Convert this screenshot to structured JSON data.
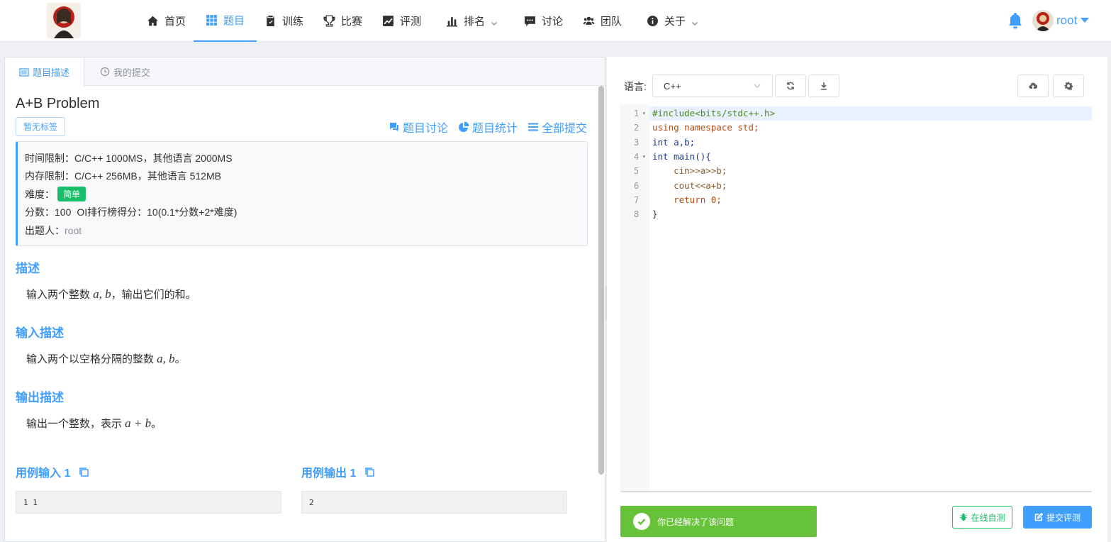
{
  "nav": {
    "items": [
      {
        "label": "首页",
        "icon": "home-icon"
      },
      {
        "label": "题目",
        "icon": "grid-icon",
        "active": true
      },
      {
        "label": "训练",
        "icon": "clipboard-icon"
      },
      {
        "label": "比赛",
        "icon": "trophy-icon"
      },
      {
        "label": "评测",
        "icon": "chart-line-icon"
      },
      {
        "label": "排名",
        "icon": "bar-chart-icon",
        "dropdown": true
      },
      {
        "label": "讨论",
        "icon": "chat-icon"
      },
      {
        "label": "团队",
        "icon": "users-icon"
      },
      {
        "label": "关于",
        "icon": "info-icon",
        "dropdown": true
      }
    ],
    "user": "root"
  },
  "tabs": {
    "description": "题目描述",
    "submissions": "我的提交"
  },
  "problem": {
    "title": "A+B Problem",
    "tag_button": "暂无标签",
    "links": {
      "discuss": "题目讨论",
      "stats": "题目统计",
      "all_submissions": "全部提交"
    },
    "info": {
      "time_limit_label": "时间限制：",
      "time_limit": "C/C++ 1000MS，其他语言 2000MS",
      "memory_limit_label": "内存限制：",
      "memory_limit": "C/C++ 256MB，其他语言 512MB",
      "difficulty_label": "难度：",
      "difficulty": "简单",
      "score_label": "分数：",
      "score": "100",
      "oi_label": "OI排行榜得分：",
      "oi_score": "10(0.1*分数+2*难度)",
      "author_label": "出题人：",
      "author": "root"
    },
    "sections": {
      "description_title": "描述",
      "description_pre": "输入两个整数 ",
      "description_math": "a, b",
      "description_post": "，输出它们的和。",
      "input_title": "输入描述",
      "input_pre": "输入两个以空格分隔的整数 ",
      "input_math": "a, b",
      "input_post": "。",
      "output_title": "输出描述",
      "output_pre": "输出一个整数，表示 ",
      "output_math": "a + b",
      "output_post": "。"
    },
    "samples": {
      "input_title": "用例输入 1",
      "input_value": "1 1",
      "output_title": "用例输出 1",
      "output_value": "2"
    }
  },
  "editor": {
    "language_label": "语言:",
    "language": "C++",
    "code_lines": [
      "#include<bits/stdc++.h>",
      "using namespace std;",
      "int a,b;",
      "int main(){",
      "    cin>>a>>b;",
      "    cout<<a+b;",
      "    return 0;",
      "}"
    ],
    "line_numbers": [
      "1",
      "2",
      "3",
      "4",
      "5",
      "6",
      "7",
      "8"
    ],
    "solved_message": "你已经解决了该问题",
    "run_button": "在线自测",
    "submit_button": "提交评测"
  },
  "colors": {
    "accent": "#409eff",
    "success": "#67c23a",
    "difficulty_easy": "#19be6b"
  }
}
